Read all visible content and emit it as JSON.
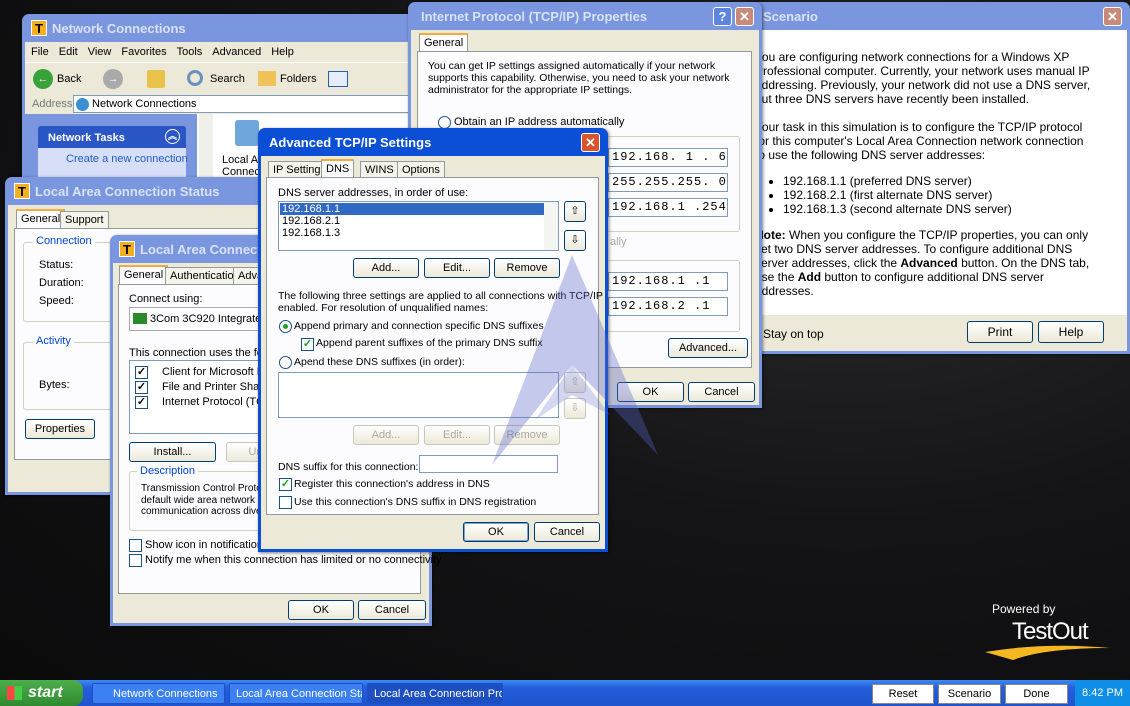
{
  "network_connections": {
    "title": "Network Connections",
    "menu": [
      "File",
      "Edit",
      "View",
      "Favorites",
      "Tools",
      "Advanced",
      "Help"
    ],
    "toolbar": {
      "back": "Back",
      "search": "Search",
      "folders": "Folders"
    },
    "address_label": "Address",
    "address_value": "Network Connections",
    "tasks_header": "Network Tasks",
    "task_create": "Create a new connection",
    "icon_label_1": "Local A",
    "icon_label_2": "Connec"
  },
  "status_window": {
    "title": "Local Area Connection Status",
    "tabs": [
      "General",
      "Support"
    ],
    "connection_group": "Connection",
    "status": "Status:",
    "duration": "Duration:",
    "speed": "Speed:",
    "activity_group": "Activity",
    "bytes": "Bytes:",
    "properties_button": "Properties"
  },
  "props_window": {
    "title": "Local Area Connection Properties",
    "tabs": [
      "General",
      "Authentication",
      "Advanced"
    ],
    "connect_using": "Connect using:",
    "adapter": "3Com 3C920 Integrated Fast Ethernet",
    "items_label": "This connection uses the following items:",
    "items": [
      {
        "label": "Client for Microsoft Networks",
        "checked": true
      },
      {
        "label": "File and Printer Sharing for Microsoft Networks",
        "checked": true
      },
      {
        "label": "Internet Protocol (TCP/IP)",
        "checked": true
      }
    ],
    "install_button": "Install...",
    "uninstall_button": "Uninstall",
    "description_group": "Description",
    "description": "Transmission Control Protocol/Internet Protocol. The default wide area network protocol that provides communication across diverse interconnected networks.",
    "show_icon": "Show icon in notification area when connected",
    "notify": "Notify me when this connection has limited or no connectivity",
    "ok": "OK",
    "cancel": "Cancel"
  },
  "tcpip_window": {
    "title": "Internet Protocol (TCP/IP) Properties",
    "tab": "General",
    "intro": "You can get IP settings assigned automatically if your network supports this capability.  Otherwise, you need to ask your network administrator for the appropriate IP settings.",
    "obtain_auto": "Obtain an IP address automatically",
    "ip_address": "192.168.  1  .  6",
    "subnet": "255.255.255.  0",
    "gateway": "192.168.1    .254",
    "dns_auto_fragment": "ally",
    "preferred_dns": "192.168.1    .1",
    "alternate_dns": "192.168.2    .1",
    "advanced_button": "Advanced...",
    "ok": "OK",
    "cancel": "Cancel"
  },
  "scenario_window": {
    "title": "Scenario",
    "para1": "You are configuring network connections for a Windows XP Professional computer. Currently, your network uses manual IP addressing. Previously, your network did not use a DNS server, but three DNS servers have recently been installed.",
    "para2": "Your task in this simulation is to configure the TCP/IP protocol for this computer's Local Area Connection network connection to use the following DNS server addresses:",
    "bullets": [
      "192.168.1.1 (preferred DNS server)",
      "192.168.2.1 (first alternate DNS server)",
      "192.168.1.3 (second alternate DNS server)"
    ],
    "note_label": "Note:",
    "note_a": " When you configure the TCP/IP properties, you can only set two DNS server addresses. To configure additional DNS server addresses, click the ",
    "note_bold1": "Advanced",
    "note_b": " button. On the DNS tab, use the ",
    "note_bold2": "Add",
    "note_c": " button to configure additional DNS server addresses.",
    "stay_on_top": "Stay on top",
    "print": "Print",
    "help": "Help"
  },
  "advanced_window": {
    "title": "Advanced TCP/IP Settings",
    "tabs": [
      "IP Settings",
      "DNS",
      "WINS",
      "Options"
    ],
    "active_tab": "DNS",
    "dns_list_label": "DNS server addresses, in order of use:",
    "dns_servers": [
      "192.168.1.1",
      "192.168.2.1",
      "192.168.1.3"
    ],
    "selected_server": "192.168.1.1",
    "add": "Add...",
    "edit": "Edit...",
    "remove": "Remove",
    "settings_text_1": "The following three settings are applied to all connections with TCP/IP",
    "settings_text_2": "enabled.  For resolution of unqualified names:",
    "append_primary": "Append primary and connection specific DNS suffixes",
    "append_parent": "Append parent suffixes of the primary DNS suffix",
    "append_these": "Apend these DNS suffixes (in order):",
    "suffix_label": "DNS suffix for this connection:",
    "suffix_value": "",
    "register": "Register this connection's address in DNS",
    "use_suffix": "Use this connection's DNS suffix in DNS registration",
    "ok": "OK",
    "cancel": "Cancel"
  },
  "branding": {
    "powered_by": "Powered by",
    "logo": "TestOut"
  },
  "taskbar": {
    "start": "start",
    "tasks": [
      "Network Connections",
      "Local Area Connection Status",
      "Local Area Connection Prop..."
    ],
    "reset": "Reset",
    "scenario": "Scenario",
    "done": "Done",
    "clock": "8:42 PM"
  },
  "colors": {
    "xp_blue": "#0a4fd6",
    "selection": "#316ac5",
    "taskbar": "#245edb",
    "start": "#3c9a3c"
  }
}
